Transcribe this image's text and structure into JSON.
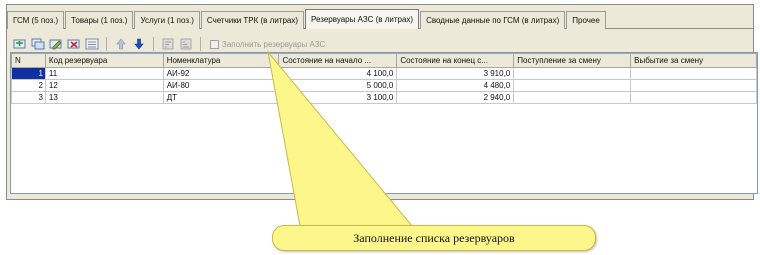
{
  "tabs": [
    {
      "label": "ГСМ (5 поз.)",
      "active": false
    },
    {
      "label": "Товары (1 поз.)",
      "active": false
    },
    {
      "label": "Услуги (1 поз.)",
      "active": false
    },
    {
      "label": "Счетчики ТРК (в литрах)",
      "active": false
    },
    {
      "label": "Резервуары АЗС (в литрах)",
      "active": true
    },
    {
      "label": "Сводные данные по ГСМ (в литрах)",
      "active": false
    },
    {
      "label": "Прочее",
      "active": false
    }
  ],
  "toolbar": {
    "icons": [
      "add-row-icon",
      "copy-row-icon",
      "edit-row-icon",
      "delete-row-icon",
      "list-icon",
      "move-up-icon",
      "move-down-icon",
      "sort-asc-icon",
      "sort-desc-icon"
    ],
    "fill_label": "Заполнить резервуары АЗС"
  },
  "table": {
    "columns": [
      "N",
      "Код резервуара",
      "Номенклатура",
      "Состояние на начало ...",
      "Состояние на конец с...",
      "Поступление за смену",
      "Выбытие за смену"
    ],
    "rows": [
      {
        "n": "1",
        "code": "11",
        "item": "АИ-92",
        "start": "4 100,0",
        "end": "3 910,0",
        "in": "",
        "out": ""
      },
      {
        "n": "2",
        "code": "12",
        "item": "АИ-80",
        "start": "5 000,0",
        "end": "4 480,0",
        "in": "",
        "out": ""
      },
      {
        "n": "3",
        "code": "13",
        "item": "ДТ",
        "start": "3 100,0",
        "end": "2 940,0",
        "in": "",
        "out": ""
      }
    ]
  },
  "callout": {
    "text": "Заполнение списка резервуаров"
  },
  "colors": {
    "callout_fill": "#fdf68a",
    "selection": "#1030a0"
  }
}
